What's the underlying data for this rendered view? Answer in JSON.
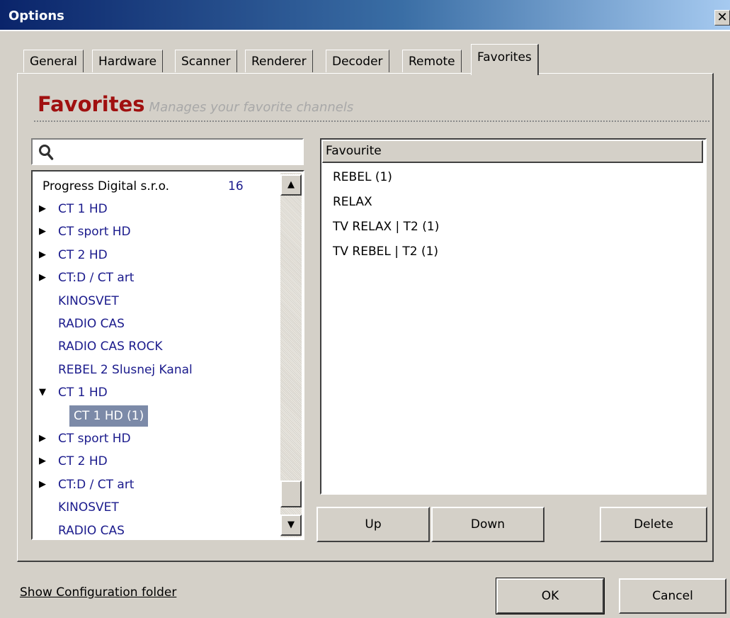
{
  "window": {
    "title": "Options",
    "close_glyph": "✕"
  },
  "tabs": [
    "General",
    "Hardware",
    "Scanner",
    "Renderer",
    "Decoder",
    "Remote",
    "Favorites"
  ],
  "active_tab": "Favorites",
  "heading": {
    "title": "Favorites",
    "subtitle": "Manages your favorite channels"
  },
  "search": {
    "value": "",
    "placeholder": "",
    "icon": "search-icon"
  },
  "tree": {
    "provider": "Progress Digital s.r.o.",
    "provider_count": "16",
    "rows": [
      {
        "label": "CT 1 HD",
        "arrow": "▶"
      },
      {
        "label": "CT sport HD",
        "arrow": "▶"
      },
      {
        "label": "CT 2 HD",
        "arrow": "▶"
      },
      {
        "label": "CT:D / CT art",
        "arrow": "▶"
      },
      {
        "label": "KINOSVET",
        "arrow": ""
      },
      {
        "label": "RADIO CAS",
        "arrow": ""
      },
      {
        "label": "RADIO CAS ROCK",
        "arrow": ""
      },
      {
        "label": "REBEL 2 Slusnej Kanal",
        "arrow": ""
      },
      {
        "label": "CT 1 HD",
        "arrow": "▼"
      },
      {
        "label": "CT 1 HD (1)",
        "arrow": "",
        "child": true,
        "selected": true
      },
      {
        "label": "CT sport HD",
        "arrow": "▶"
      },
      {
        "label": "CT 2 HD",
        "arrow": "▶"
      },
      {
        "label": "CT:D / CT art",
        "arrow": "▶"
      },
      {
        "label": "KINOSVET",
        "arrow": ""
      },
      {
        "label": "RADIO CAS",
        "arrow": ""
      }
    ]
  },
  "scrollbar": {
    "up_glyph": "▲",
    "down_glyph": "▼"
  },
  "favorites": {
    "header": "Favourite",
    "items": [
      "REBEL (1)",
      "RELAX",
      "TV RELAX | T2 (1)",
      "TV REBEL | T2 (1)"
    ]
  },
  "buttons": {
    "up": "Up",
    "down": "Down",
    "delete": "Delete",
    "ok": "OK",
    "cancel": "Cancel"
  },
  "footer_link": "Show Configuration folder"
}
